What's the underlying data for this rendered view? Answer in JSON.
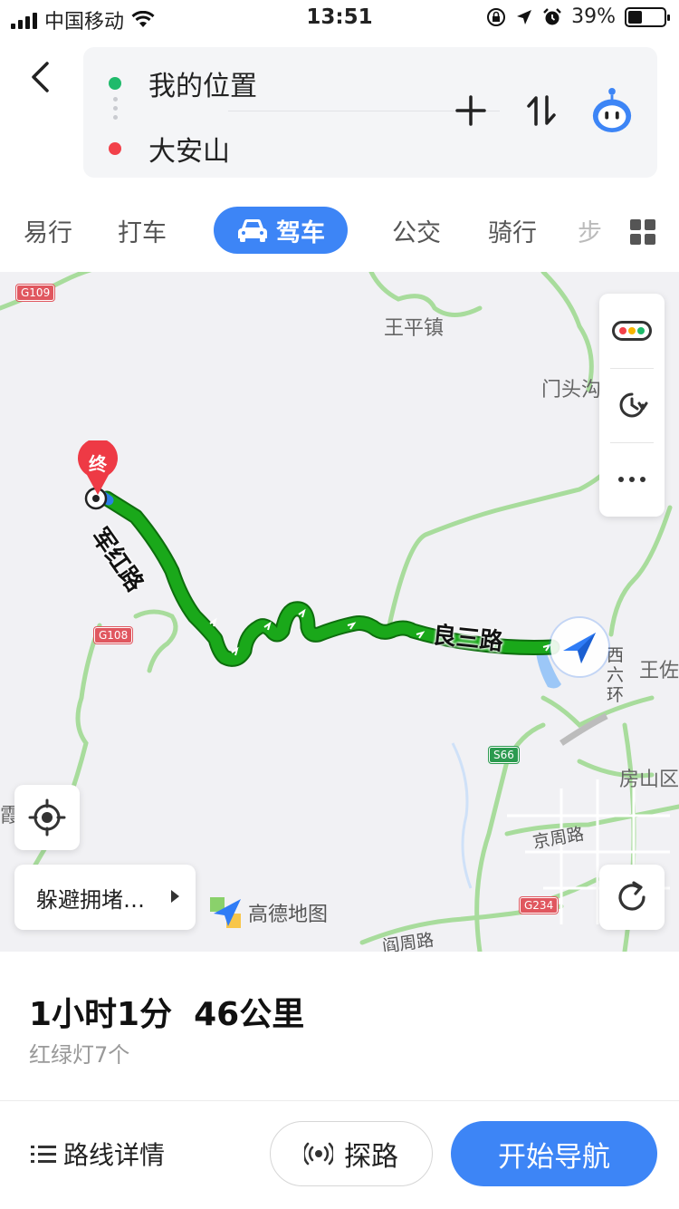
{
  "status_bar": {
    "carrier": "中国移动",
    "time": "13:51",
    "battery": "39%",
    "battery_level": 0.39
  },
  "route": {
    "from": "我的位置",
    "to": "大安山",
    "from_color": "#1fba6b",
    "to_color": "#f2414a"
  },
  "modes": {
    "items": [
      "易行",
      "打车",
      "驾车",
      "公交",
      "骑行",
      "步"
    ],
    "active": "驾车",
    "accent": "#3d85f6"
  },
  "map": {
    "labels": [
      "王平镇",
      "门头沟",
      "王佐",
      "房山区",
      "京周路",
      "阎周路",
      "西六环",
      "霞云岭乡"
    ],
    "shields": [
      "G109",
      "G108",
      "S66",
      "G234"
    ],
    "road_names": [
      "军红路",
      "良三路"
    ],
    "end_marker": "终",
    "avoid_label": "躲避拥堵…",
    "brand": "高德地图",
    "route_color": "#1aa81a"
  },
  "summary": {
    "duration": "1小时1分",
    "distance": "46公里",
    "traffic_lights": "红绿灯7个"
  },
  "actions": {
    "detail": "路线详情",
    "probe": "探路",
    "navigate": "开始导航"
  }
}
